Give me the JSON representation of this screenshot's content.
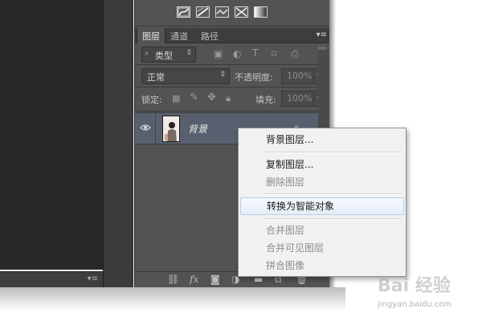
{
  "layers_panel": {
    "tabs": [
      {
        "label": "图层",
        "active": true
      },
      {
        "label": "通道",
        "active": false
      },
      {
        "label": "路径",
        "active": false
      }
    ],
    "panel_menu_icon": "panel-menu-icon",
    "filter": {
      "icon": "search-icon",
      "value": "类型"
    },
    "blend_mode": "正常",
    "opacity": {
      "label": "不透明度:",
      "value": "100%"
    },
    "lock": {
      "label": "锁定:"
    },
    "fill": {
      "label": "填充:",
      "value": "100%"
    },
    "layer": {
      "name": "背景",
      "visible": true,
      "locked": true
    },
    "bottom_icons": [
      "link-icon",
      "fx-icon",
      "mask-icon",
      "adjustment-icon",
      "group-icon",
      "new-layer-icon",
      "trash-icon"
    ],
    "fx_label": "fx"
  },
  "context_menu": {
    "items": [
      {
        "label": "背景图层...",
        "enabled": true
      },
      {
        "label": "复制图层...",
        "enabled": true
      },
      {
        "label": "删除图层",
        "enabled": false
      },
      {
        "label": "转换为智能对象",
        "enabled": true,
        "highlighted": true
      },
      {
        "label": "合并图层",
        "enabled": false
      },
      {
        "label": "合并可见图层",
        "enabled": false
      },
      {
        "label": "拼合图像",
        "enabled": false
      }
    ]
  },
  "watermark": {
    "text": "Bai 经验",
    "sub": "jingyan.baidu.com"
  },
  "colors": {
    "panel_bg": "#535353",
    "canvas_bg": "#282828",
    "selected_layer": "#58606f",
    "menu_bg": "#f1f1f1",
    "menu_highlight_border": "#b9cfe9"
  }
}
